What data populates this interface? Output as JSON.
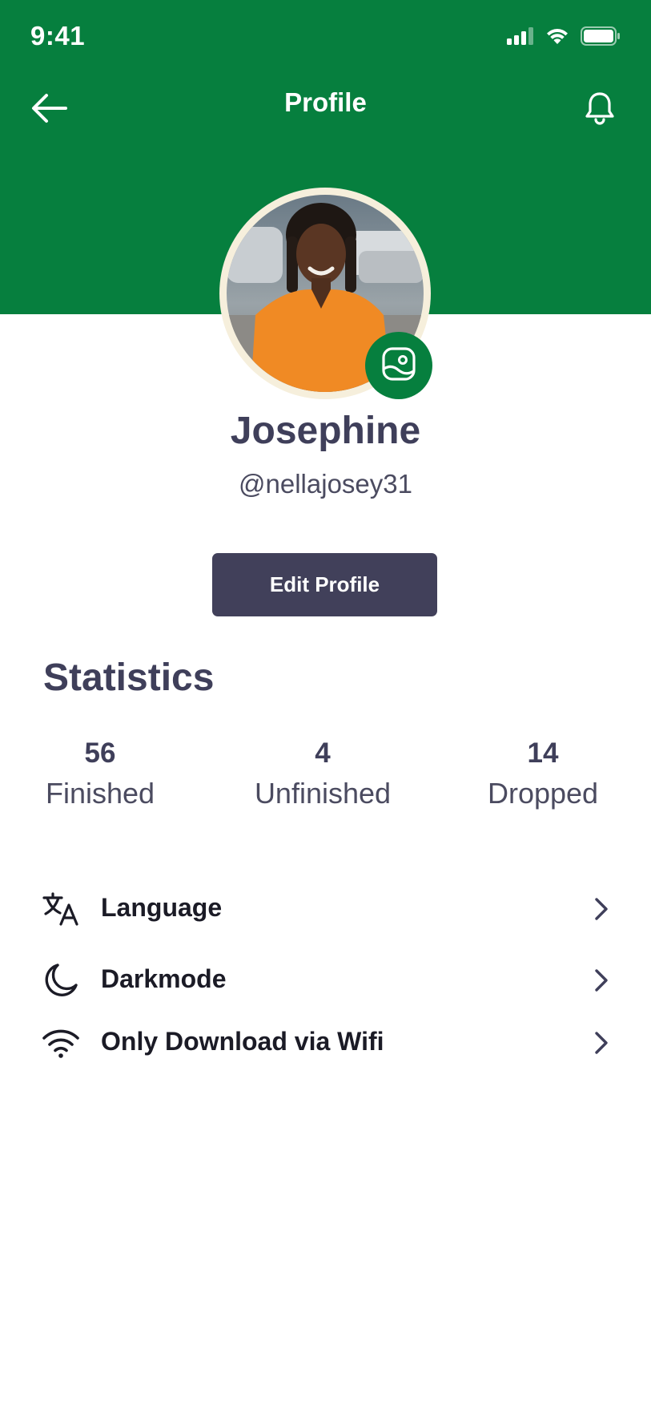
{
  "status_bar": {
    "time": "9:41"
  },
  "nav": {
    "title": "Profile"
  },
  "profile": {
    "name": "Josephine",
    "handle": "@nellajosey31",
    "edit_button_label": "Edit Profile"
  },
  "statistics": {
    "title": "Statistics",
    "items": [
      {
        "value": "56",
        "label": "Finished"
      },
      {
        "value": "4",
        "label": "Unfinished"
      },
      {
        "value": "14",
        "label": "Dropped"
      }
    ]
  },
  "settings": {
    "items": [
      {
        "label": "Language",
        "icon": "translate-icon"
      },
      {
        "label": "Darkmode",
        "icon": "moon-icon"
      },
      {
        "label": "Only Download via Wifi",
        "icon": "wifi-icon"
      }
    ]
  },
  "colors": {
    "header_green": "#067f3e",
    "button_dark": "#41405a",
    "text_dark": "#3f3f5a"
  }
}
